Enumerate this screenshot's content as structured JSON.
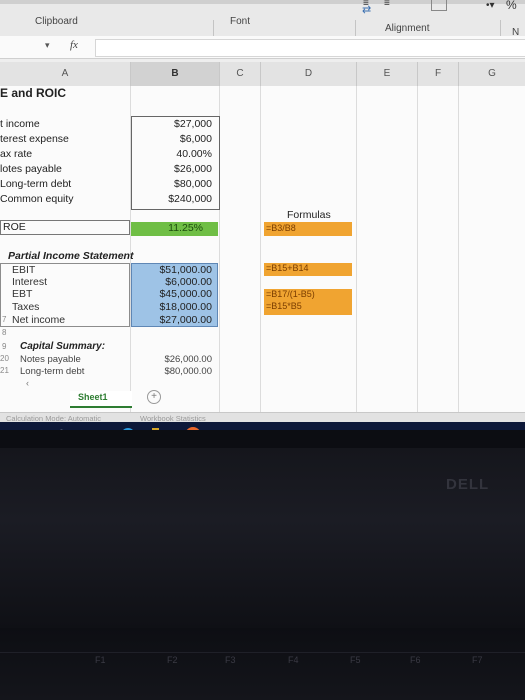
{
  "ribbon": {
    "clipboard_label": "Clipboard",
    "font_label": "Font",
    "alignment_label": "Alignment",
    "number_label": "N"
  },
  "formula_bar": {
    "fx_label": "fx"
  },
  "columns": [
    "A",
    "B",
    "C",
    "D",
    "E",
    "F",
    "G"
  ],
  "sheet": {
    "title": "E and ROIC",
    "inputs": [
      {
        "label": "t income",
        "value": "$27,000"
      },
      {
        "label": "terest expense",
        "value": "$6,000"
      },
      {
        "label": "ax rate",
        "value": "40.00%"
      },
      {
        "label": "lotes payable",
        "value": "$26,000"
      },
      {
        "label": "Long-term debt",
        "value": "$80,000"
      },
      {
        "label": "Common equity",
        "value": "$240,000"
      }
    ],
    "roe_label": "ROE",
    "roe_value": "11.25%",
    "formulas_header": "Formulas",
    "roe_formula": "=B3/B8",
    "partial_title": "Partial Income Statement",
    "partial_rows": [
      {
        "label": "EBIT",
        "value": "$51,000.00"
      },
      {
        "label": "Interest",
        "value": "$6,000.00"
      },
      {
        "label": "EBT",
        "value": "$45,000.00"
      },
      {
        "label": "Taxes",
        "value": "$18,000.00"
      },
      {
        "label": "Net income",
        "value": "$27,000.00"
      }
    ],
    "ebit_formula": "=B15+B14",
    "taxes_formula_1": "=B17/(1-B5)",
    "taxes_formula_2": "=B15*B5",
    "capital_title": "Capital Summary:",
    "capital_rows": [
      {
        "label": "Notes payable",
        "value": "$26,000.00"
      },
      {
        "label": "Long-term debt",
        "value": "$80,000.00"
      }
    ],
    "row_numbers": [
      "7",
      "8",
      "9",
      "20",
      "21"
    ]
  },
  "tabs": {
    "active": "Sheet1"
  },
  "statusbar": {
    "calc_mode": "Calculation Mode: Automatic",
    "stats": "Workbook Statistics"
  },
  "laptop": {
    "brand": "DELL",
    "keys": [
      "F1",
      "F2",
      "F3",
      "F4",
      "F5",
      "F6",
      "F7"
    ]
  },
  "colors": {
    "input_fill": "#9ec3e6",
    "roe_fill": "#6fbe45",
    "formula_fill": "#f0a431",
    "taskbar": "#0d1838"
  }
}
